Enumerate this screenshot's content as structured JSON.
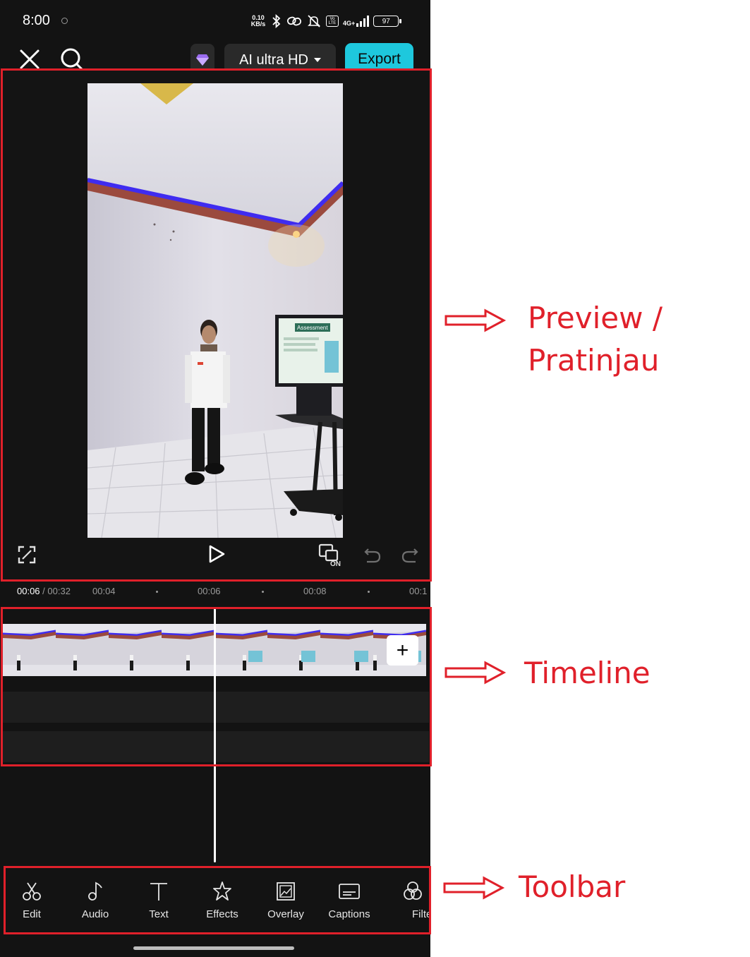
{
  "status_bar": {
    "time": "8:00",
    "net_speed_value": "0.10",
    "net_speed_unit": "KB/s",
    "volte_label": "Vo LTE",
    "network_type": "4G+",
    "battery": "97"
  },
  "top_bar": {
    "quality_label": "AI ultra HD",
    "export_label": "Export"
  },
  "preview": {
    "screen_label": "Assessment",
    "capture_on_label": "ON"
  },
  "ruler": {
    "current": "00:06",
    "separator": " / ",
    "total": "00:32",
    "ticks": [
      "00:04",
      "00:06",
      "00:08",
      "00:1"
    ]
  },
  "timeline": {
    "add_label": "+"
  },
  "toolbar": {
    "items": [
      {
        "label": "Edit",
        "icon": "scissors-icon"
      },
      {
        "label": "Audio",
        "icon": "music-note-icon"
      },
      {
        "label": "Text",
        "icon": "text-icon"
      },
      {
        "label": "Effects",
        "icon": "star-icon"
      },
      {
        "label": "Overlay",
        "icon": "overlay-icon"
      },
      {
        "label": "Captions",
        "icon": "captions-icon"
      },
      {
        "label": "Filte",
        "icon": "filters-icon"
      }
    ]
  },
  "annotations": {
    "preview_line1": "Preview /",
    "preview_line2": "Pratinjau",
    "timeline": "Timeline",
    "toolbar": "Toolbar"
  },
  "colors": {
    "accent": "#1ec8dd",
    "annotation": "#e0202a",
    "background": "#131313"
  }
}
